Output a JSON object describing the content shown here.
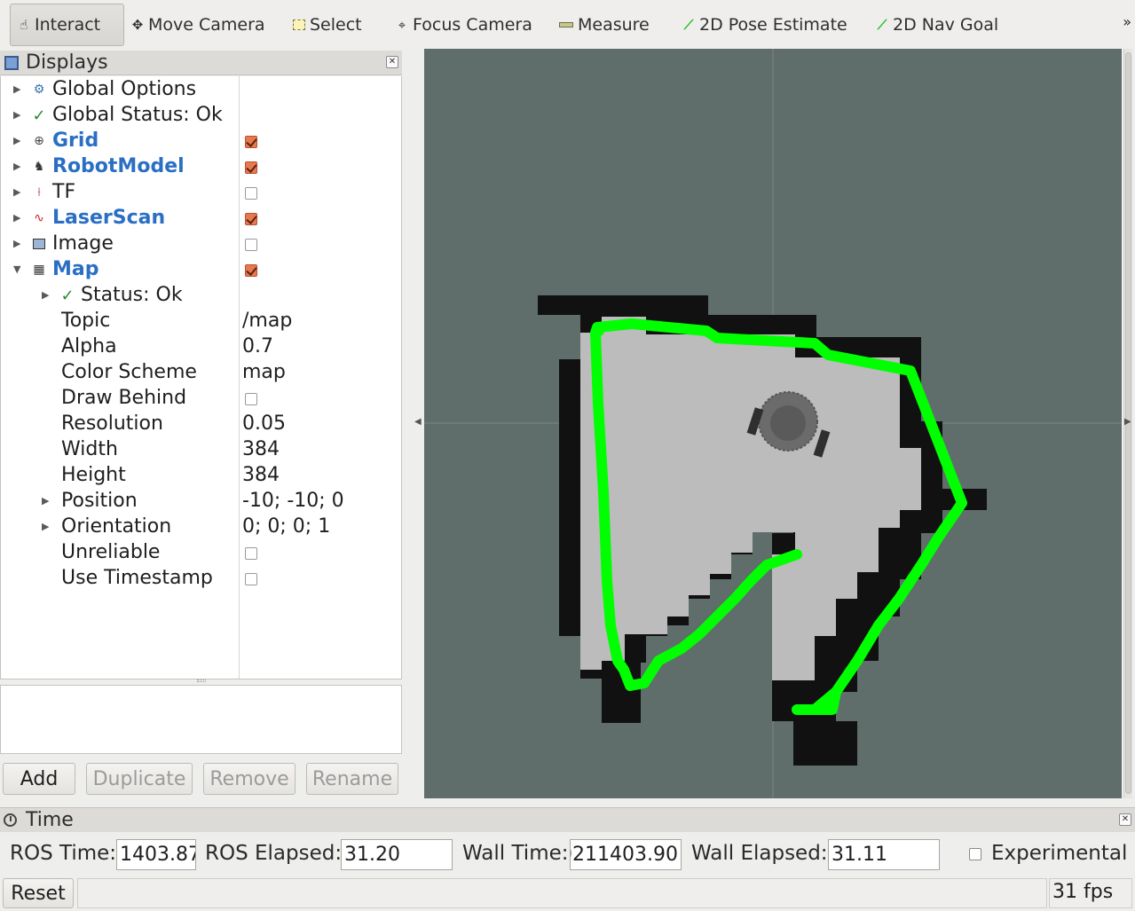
{
  "toolbar": {
    "tools": [
      {
        "label": "Interact",
        "icon": "hand-icon"
      },
      {
        "label": "Move Camera",
        "icon": "move-camera-icon"
      },
      {
        "label": "Select",
        "icon": "select-icon"
      },
      {
        "label": "Focus Camera",
        "icon": "focus-camera-icon"
      },
      {
        "label": "Measure",
        "icon": "measure-icon"
      },
      {
        "label": "2D Pose Estimate",
        "icon": "pose-arrow-icon"
      },
      {
        "label": "2D Nav Goal",
        "icon": "nav-goal-arrow-icon"
      }
    ],
    "active_tool": "Interact",
    "more": "»"
  },
  "displays": {
    "title": "Displays",
    "items": [
      {
        "label": "Global Options",
        "icon": "gear-icon"
      },
      {
        "label": "Global Status: Ok",
        "icon": "check-icon"
      },
      {
        "label": "Grid",
        "icon": "grid-icon",
        "enabled": true
      },
      {
        "label": "RobotModel",
        "icon": "robot-model-icon",
        "enabled": true
      },
      {
        "label": "TF",
        "icon": "tf-axes-icon",
        "enabled": false
      },
      {
        "label": "LaserScan",
        "icon": "laser-scan-icon",
        "enabled": true
      },
      {
        "label": "Image",
        "icon": "image-icon",
        "enabled": false
      },
      {
        "label": "Map",
        "icon": "map-icon",
        "enabled": true,
        "expanded": true
      }
    ],
    "map_props": {
      "status": "Status: Ok",
      "topic_label": "Topic",
      "topic_value": "/map",
      "alpha_label": "Alpha",
      "alpha_value": "0.7",
      "color_scheme_label": "Color Scheme",
      "color_scheme_value": "map",
      "draw_behind_label": "Draw Behind",
      "draw_behind_value": false,
      "resolution_label": "Resolution",
      "resolution_value": "0.05",
      "width_label": "Width",
      "width_value": "384",
      "height_label": "Height",
      "height_value": "384",
      "position_label": "Position",
      "position_value": "-10; -10; 0",
      "orientation_label": "Orientation",
      "orientation_value": "0; 0; 0; 1",
      "unreliable_label": "Unreliable",
      "unreliable_value": false,
      "use_timestamp_label": "Use Timestamp",
      "use_timestamp_value": false
    },
    "buttons": {
      "add": "Add",
      "duplicate": "Duplicate",
      "remove": "Remove",
      "rename": "Rename"
    }
  },
  "time": {
    "title": "Time",
    "ros_time_label": "ROS Time:",
    "ros_time_value": "1403.87",
    "ros_elapsed_label": "ROS Elapsed:",
    "ros_elapsed_value": "31.20",
    "wall_time_label": "Wall Time:",
    "wall_time_value": "0211403.90",
    "wall_elapsed_label": "Wall Elapsed:",
    "wall_elapsed_value": "31.11",
    "experimental_label": "Experimental"
  },
  "status": {
    "reset": "Reset",
    "fps": "31 fps"
  },
  "colors": {
    "viewport_bg": "#5f6d6b",
    "map_free": "#bcbcbc",
    "map_occupied": "#111111",
    "laser_scan": "#00ff00",
    "checkbox_on": "#e8784e",
    "tree_label_blue": "#2a6fc4"
  }
}
